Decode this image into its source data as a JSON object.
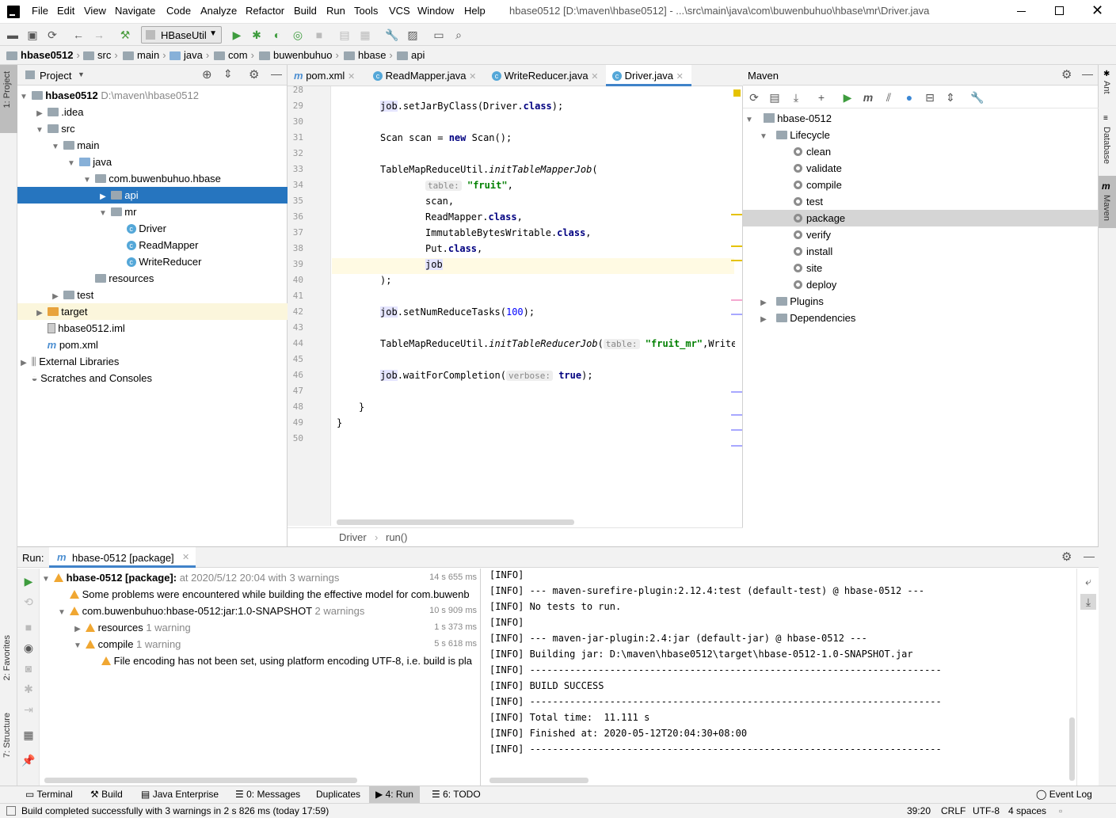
{
  "window": {
    "title": "hbase0512 [D:\\maven\\hbase0512] - ...\\src\\main\\java\\com\\buwenbuhuo\\hbase\\mr\\Driver.java",
    "menu": [
      "File",
      "Edit",
      "View",
      "Navigate",
      "Code",
      "Analyze",
      "Refactor",
      "Build",
      "Run",
      "Tools",
      "VCS",
      "Window",
      "Help"
    ]
  },
  "toolbar": {
    "run_config": "HBaseUtil"
  },
  "breadcrumb": [
    "hbase0512",
    "src",
    "main",
    "java",
    "com",
    "buwenbuhuo",
    "hbase",
    "api"
  ],
  "left_tabs": {
    "project": "1: Project",
    "favorites": "2: Favorites",
    "structure": "7: Structure"
  },
  "project": {
    "title": "Project",
    "tree": [
      {
        "label": "hbase0512",
        "extra": "D:\\maven\\hbase0512",
        "depth": 0,
        "arrow": "open",
        "icon": "folder",
        "bold": true
      },
      {
        "label": ".idea",
        "depth": 1,
        "arrow": "closed",
        "icon": "folder"
      },
      {
        "label": "src",
        "depth": 1,
        "arrow": "open",
        "icon": "folder"
      },
      {
        "label": "main",
        "depth": 2,
        "arrow": "open",
        "icon": "folder"
      },
      {
        "label": "java",
        "depth": 3,
        "arrow": "open",
        "icon": "folder-blue"
      },
      {
        "label": "com.buwenbuhuo.hbase",
        "depth": 4,
        "arrow": "open",
        "icon": "folder"
      },
      {
        "label": "api",
        "depth": 5,
        "arrow": "closed",
        "icon": "folder",
        "selected": true
      },
      {
        "label": "mr",
        "depth": 5,
        "arrow": "open",
        "icon": "folder"
      },
      {
        "label": "Driver",
        "depth": 6,
        "arrow": "",
        "icon": "class"
      },
      {
        "label": "ReadMapper",
        "depth": 6,
        "arrow": "",
        "icon": "class"
      },
      {
        "label": "WriteReducer",
        "depth": 6,
        "arrow": "",
        "icon": "class"
      },
      {
        "label": "resources",
        "depth": 4,
        "arrow": "",
        "icon": "folder"
      },
      {
        "label": "test",
        "depth": 2,
        "arrow": "closed",
        "icon": "folder"
      },
      {
        "label": "target",
        "depth": 1,
        "arrow": "closed",
        "icon": "folder-orange",
        "highlight": true
      },
      {
        "label": "hbase0512.iml",
        "depth": 1,
        "arrow": "",
        "icon": "file"
      },
      {
        "label": "pom.xml",
        "depth": 1,
        "arrow": "",
        "icon": "maven"
      },
      {
        "label": "External Libraries",
        "depth": 0,
        "arrow": "closed",
        "icon": "lib"
      },
      {
        "label": "Scratches and Consoles",
        "depth": 0,
        "arrow": "",
        "icon": "scratch"
      }
    ]
  },
  "editor": {
    "tabs": [
      "pom.xml",
      "ReadMapper.java",
      "WriteReducer.java",
      "Driver.java"
    ],
    "active_tab": "Driver.java",
    "lines": [
      28,
      29,
      30,
      31,
      32,
      33,
      34,
      35,
      36,
      37,
      38,
      39,
      40,
      41,
      42,
      43,
      44,
      45,
      46,
      47,
      48,
      49,
      50
    ],
    "code": {
      "l29a": "job",
      "l29b": ".setJarByClass(Driver.",
      "l29c": "class",
      "l29d": ");",
      "l31a": "Scan scan = ",
      "l31b": "new",
      "l31c": " Scan();",
      "l33a": "TableMapReduceUtil.",
      "l33b": "initTableMapperJob",
      "l33c": "(",
      "l34_hint": "table:",
      "l34_str": "\"fruit\"",
      "l34_end": ",",
      "l35": "scan,",
      "l36a": "ReadMapper.",
      "l36b": "class",
      "l36c": ",",
      "l37a": "ImmutableBytesWritable.",
      "l37b": "class",
      "l37c": ",",
      "l38a": "Put.",
      "l38b": "class",
      "l38c": ",",
      "l39": "job",
      "l40": ");",
      "l42a": "job",
      "l42b": ".setNumReduceTasks(",
      "l42c": "100",
      "l42d": ");",
      "l44a": "TableMapReduceUtil.",
      "l44b": "initTableReducerJob",
      "l44c": "(",
      "l44_hint": "table:",
      "l44_str": "\"fruit_mr\"",
      "l44_end": ",WriteRedu",
      "l46a": "job",
      "l46b": ".waitForCompletion(",
      "l46_hint": "verbose:",
      "l46_kw": "true",
      "l46_end": ");",
      "l48": "}",
      "l49": "}"
    },
    "footer_crumb": [
      "Driver",
      "run()"
    ]
  },
  "maven": {
    "title": "Maven",
    "project": "hbase-0512",
    "lifecycle_label": "Lifecycle",
    "goals": [
      "clean",
      "validate",
      "compile",
      "test",
      "package",
      "verify",
      "install",
      "site",
      "deploy"
    ],
    "selected_goal": "package",
    "plugins_label": "Plugins",
    "dependencies_label": "Dependencies"
  },
  "right_tabs": {
    "ant": "Ant",
    "database": "Database",
    "maven": "Maven"
  },
  "run": {
    "label": "Run:",
    "tab": "hbase-0512 [package]",
    "tree": [
      {
        "label": "hbase-0512 [package]:",
        "suffix": " at 2020/5/12 20:04 with 3 warnings",
        "time": "14 s 655 ms",
        "depth": 0,
        "arrow": "open",
        "bold": true
      },
      {
        "label": "Some problems were encountered while building the effective model for com.buwenb",
        "suffix": "",
        "time": "",
        "depth": 1,
        "arrow": ""
      },
      {
        "label": "com.buwenbuhuo:hbase-0512:jar:1.0-SNAPSHOT",
        "suffix": "  2 warnings",
        "time": "10 s 909 ms",
        "depth": 1,
        "arrow": "open"
      },
      {
        "label": "resources",
        "suffix": "  1 warning",
        "time": "1 s 373 ms",
        "depth": 2,
        "arrow": "closed"
      },
      {
        "label": "compile",
        "suffix": "  1 warning",
        "time": "5 s 618 ms",
        "depth": 2,
        "arrow": "open"
      },
      {
        "label": "File encoding has not been set, using platform encoding UTF-8, i.e. build is pla",
        "suffix": "",
        "time": "",
        "depth": 3,
        "arrow": ""
      }
    ],
    "console": [
      "[INFO]",
      "[INFO] --- maven-surefire-plugin:2.12.4:test (default-test) @ hbase-0512 ---",
      "[INFO] No tests to run.",
      "[INFO]",
      "[INFO] --- maven-jar-plugin:2.4:jar (default-jar) @ hbase-0512 ---",
      "[INFO] Building jar: D:\\maven\\hbase0512\\target\\hbase-0512-1.0-SNAPSHOT.jar",
      "[INFO] ------------------------------------------------------------------------",
      "[INFO] BUILD SUCCESS",
      "[INFO] ------------------------------------------------------------------------",
      "[INFO] Total time:  11.111 s",
      "[INFO] Finished at: 2020-05-12T20:04:30+08:00",
      "[INFO] ------------------------------------------------------------------------"
    ]
  },
  "bottom_tabs": {
    "terminal": "Terminal",
    "build": "Build",
    "java_enterprise": "Java Enterprise",
    "messages": "0: Messages",
    "duplicates": "Duplicates",
    "run": "4: Run",
    "todo": "6: TODO",
    "event_log": "Event Log"
  },
  "status": {
    "message": "Build completed successfully with 3 warnings in 2 s 826 ms (today 17:59)",
    "position": "39:20",
    "line_sep": "CRLF",
    "encoding": "UTF-8",
    "indent": "4 spaces"
  }
}
